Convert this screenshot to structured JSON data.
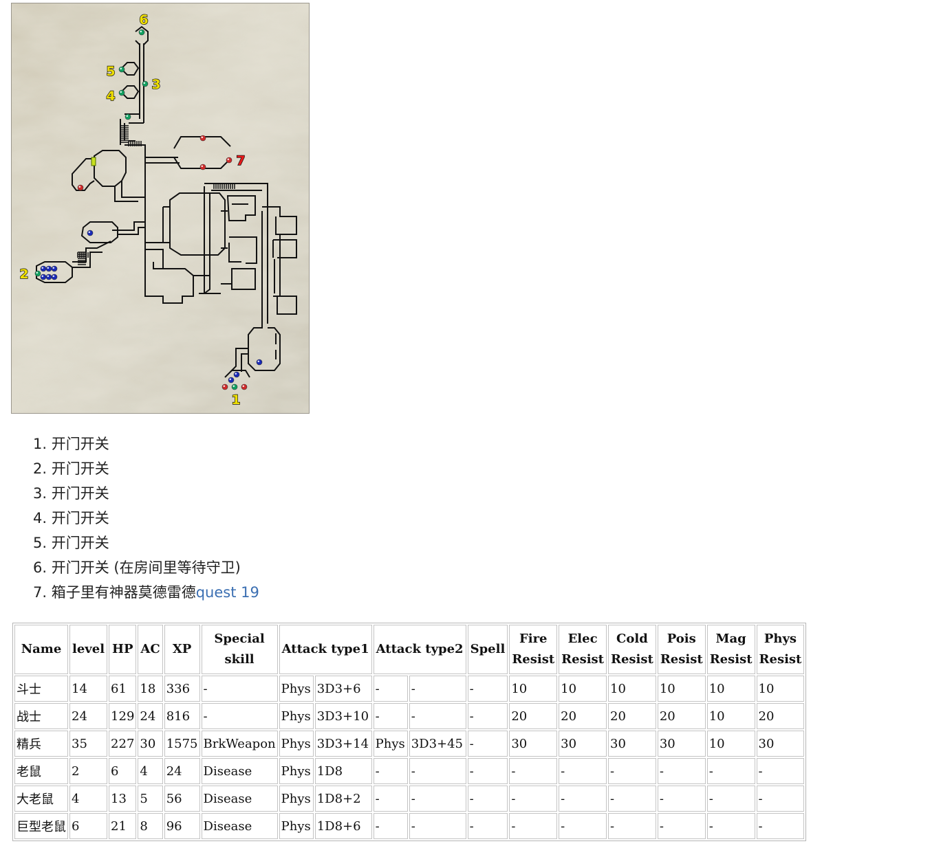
{
  "map": {
    "markers": [
      {
        "id": "1",
        "label": "1",
        "color": "#f0e000"
      },
      {
        "id": "2",
        "label": "2",
        "color": "#f0e000"
      },
      {
        "id": "3",
        "label": "3",
        "color": "#f0e000"
      },
      {
        "id": "4",
        "label": "4",
        "color": "#f0e000"
      },
      {
        "id": "5",
        "label": "5",
        "color": "#f0e000"
      },
      {
        "id": "6",
        "label": "6",
        "color": "#f0e000"
      },
      {
        "id": "7",
        "label": "7",
        "color": "#e81a1a"
      }
    ],
    "dot_colors": {
      "red": "#d02a2a",
      "blue": "#1a2ab8",
      "green": "#12a060",
      "switch": "#c8e020"
    }
  },
  "notes": [
    {
      "text": "开门开关",
      "link": ""
    },
    {
      "text": "开门开关",
      "link": ""
    },
    {
      "text": "开门开关",
      "link": ""
    },
    {
      "text": "开门开关",
      "link": ""
    },
    {
      "text": "开门开关",
      "link": ""
    },
    {
      "text": "开门开关 (在房间里等待守卫)",
      "link": ""
    },
    {
      "text": "箱子里有神器莫德雷德",
      "link": "quest 19"
    }
  ],
  "table": {
    "headers": [
      {
        "label": "Name",
        "colspan": 1
      },
      {
        "label": "level",
        "colspan": 1
      },
      {
        "label": "HP",
        "colspan": 1
      },
      {
        "label": "AC",
        "colspan": 1
      },
      {
        "label": "XP",
        "colspan": 1
      },
      {
        "label": "Special skill",
        "colspan": 1
      },
      {
        "label": "Attack type1",
        "colspan": 2
      },
      {
        "label": "Attack type2",
        "colspan": 2
      },
      {
        "label": "Spell",
        "colspan": 1
      },
      {
        "label": "Fire Resist",
        "colspan": 1
      },
      {
        "label": "Elec Resist",
        "colspan": 1
      },
      {
        "label": "Cold Resist",
        "colspan": 1
      },
      {
        "label": "Pois Resist",
        "colspan": 1
      },
      {
        "label": "Mag Resist",
        "colspan": 1
      },
      {
        "label": "Phys Resist",
        "colspan": 1
      }
    ],
    "rows": [
      [
        "斗士",
        "14",
        "61",
        "18",
        "336",
        "-",
        "Phys",
        "3D3+6",
        "-",
        "-",
        "-",
        "10",
        "10",
        "10",
        "10",
        "10",
        "10"
      ],
      [
        "战士",
        "24",
        "129",
        "24",
        "816",
        "-",
        "Phys",
        "3D3+10",
        "-",
        "-",
        "-",
        "20",
        "20",
        "20",
        "20",
        "10",
        "20"
      ],
      [
        "精兵",
        "35",
        "227",
        "30",
        "1575",
        "BrkWeapon",
        "Phys",
        "3D3+14",
        "Phys",
        "3D3+45",
        "-",
        "30",
        "30",
        "30",
        "30",
        "10",
        "30"
      ],
      [
        "老鼠",
        "2",
        "6",
        "4",
        "24",
        "Disease",
        "Phys",
        "1D8",
        "-",
        "-",
        "-",
        "-",
        "-",
        "-",
        "-",
        "-",
        "-"
      ],
      [
        "大老鼠",
        "4",
        "13",
        "5",
        "56",
        "Disease",
        "Phys",
        "1D8+2",
        "-",
        "-",
        "-",
        "-",
        "-",
        "-",
        "-",
        "-",
        "-"
      ],
      [
        "巨型老鼠",
        "6",
        "21",
        "8",
        "96",
        "Disease",
        "Phys",
        "1D8+6",
        "-",
        "-",
        "-",
        "-",
        "-",
        "-",
        "-",
        "-",
        "-"
      ]
    ]
  }
}
